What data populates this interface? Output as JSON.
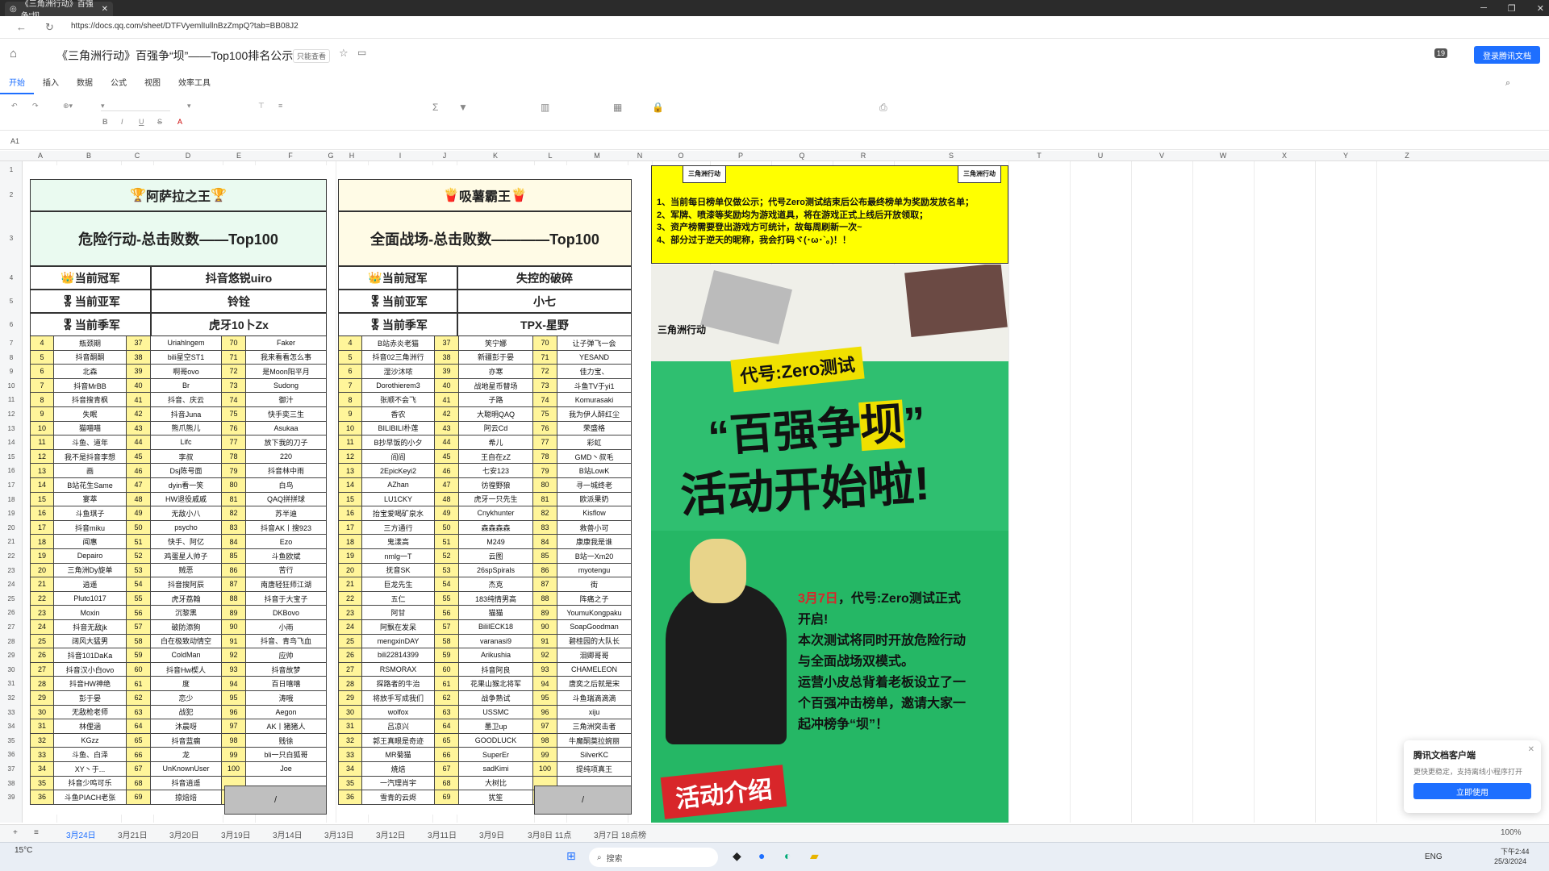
{
  "browser": {
    "tab_title": "《三角洲行动》百强争“坝",
    "url": "https://docs.qq.com/sheet/DTFVyemlIullnBzZmpQ?tab=BB08J2"
  },
  "doc": {
    "title": "《三角洲行动》百强争“坝”——Top100排名公示",
    "save_state": "只能查看",
    "login_button": "登录腾讯文档",
    "collab_count": "19"
  },
  "menu": [
    "开始",
    "插入",
    "数据",
    "公式",
    "视图",
    "效率工具"
  ],
  "cell_ref": "A1",
  "columns": [
    "A",
    "B",
    "C",
    "D",
    "E",
    "F",
    "G",
    "H",
    "I",
    "J",
    "K",
    "L",
    "M",
    "N",
    "O",
    "P",
    "Q",
    "R",
    "S",
    "T",
    "U",
    "V",
    "W",
    "X",
    "Y",
    "Z"
  ],
  "rows": [
    "1",
    "2",
    "3",
    "4",
    "5",
    "6",
    "7",
    "8",
    "9",
    "10",
    "11",
    "12",
    "13",
    "14",
    "15",
    "16",
    "17",
    "18",
    "19",
    "20",
    "21",
    "22",
    "23",
    "24",
    "25",
    "26",
    "27",
    "28",
    "29",
    "30",
    "31",
    "32",
    "33",
    "34",
    "35",
    "36",
    "37",
    "38",
    "39"
  ],
  "left": {
    "badge": "阿萨拉之王",
    "title": "危险行动-总击败数——Top100",
    "champ_label": "当前冠军",
    "champ": "抖音悠锐uiro",
    "runner_label": "当前亚军",
    "runner": "铃铨",
    "third_label": "当前季军",
    "third": "虎牙10卜Zx",
    "rows": [
      [
        "4",
        "瓶颈期",
        "37",
        "Uriahlngem",
        "70",
        "Faker"
      ],
      [
        "5",
        "抖音酮酮",
        "38",
        "bili星空ST1",
        "71",
        "我来看看怎么事"
      ],
      [
        "6",
        "北森",
        "39",
        "啊哥ovo",
        "72",
        "是Moon阳平月"
      ],
      [
        "7",
        "抖音MrBB",
        "40",
        "Br",
        "73",
        "Sudong"
      ],
      [
        "8",
        "抖音搜青枫",
        "41",
        "抖音、庆云",
        "74",
        "御汁"
      ],
      [
        "9",
        "失眠",
        "42",
        "抖音Juna",
        "75",
        "快手奕三生"
      ],
      [
        "10",
        "猫喵喵",
        "43",
        "熊爪熊儿",
        "76",
        "Asukaa"
      ],
      [
        "11",
        "斗鱼、道年",
        "44",
        "Lifc",
        "77",
        "放下我的刀子"
      ],
      [
        "12",
        "我不是抖音李想",
        "45",
        "李叔",
        "78",
        "220"
      ],
      [
        "13",
        "画",
        "46",
        "Dsj陈号面",
        "79",
        "抖音林中雨"
      ],
      [
        "14",
        "B站花生Same",
        "47",
        "dyin看一笑",
        "80",
        "白鸟"
      ],
      [
        "15",
        "宴萃",
        "48",
        "HW退役戚戚",
        "81",
        "QAQ拼拼球"
      ],
      [
        "16",
        "斗鱼琪子",
        "49",
        "无敌小八",
        "82",
        "苏半迪"
      ],
      [
        "17",
        "抖音miku",
        "50",
        "psycho",
        "83",
        "抖音AK丨搜923"
      ],
      [
        "18",
        "闻惠",
        "51",
        "快手、阿亿",
        "84",
        "Ezo"
      ],
      [
        "19",
        "Depairo",
        "52",
        "鸡蛋星人帅子",
        "85",
        "斗鱼欧斌"
      ],
      [
        "20",
        "三角洲Dy旋单",
        "53",
        "贼恶",
        "86",
        "苦行"
      ],
      [
        "21",
        "逍遥",
        "54",
        "抖音搜阿辰",
        "87",
        "南唐轻狂师江湖"
      ],
      [
        "22",
        "Pluto1017",
        "55",
        "虎牙荔翰",
        "88",
        "抖音于大宝子"
      ],
      [
        "23",
        "Moxin",
        "56",
        "沉黎黑",
        "89",
        "DKBovo"
      ],
      [
        "24",
        "抖音无敌jk",
        "57",
        "破防添狗",
        "90",
        "小雨"
      ],
      [
        "25",
        "阔风大猛男",
        "58",
        "白在极致动情空",
        "91",
        "抖音、青鸟飞血"
      ],
      [
        "26",
        "抖音101DaKa",
        "59",
        "ColdMan",
        "92",
        "应帅"
      ],
      [
        "27",
        "抖音汉小白ovo",
        "60",
        "抖音Hw楔人",
        "93",
        "抖音故梦"
      ],
      [
        "28",
        "抖音HW神绝",
        "61",
        "度",
        "94",
        "百日嘻嘻"
      ],
      [
        "29",
        "彭于晏",
        "62",
        "恋少",
        "95",
        "涛哦"
      ],
      [
        "30",
        "无敌枪老师",
        "63",
        "战犯",
        "96",
        "Aegon"
      ],
      [
        "31",
        "林俚涵",
        "64",
        "沐晨呀",
        "97",
        "AK丨猪猪人"
      ],
      [
        "32",
        "KGzz",
        "65",
        "抖音蓝瘸",
        "98",
        "贱徐"
      ],
      [
        "33",
        "斗鱼、白泽",
        "66",
        "龙",
        "99",
        "bli一只白狐哥"
      ],
      [
        "34",
        "XY丶于...",
        "67",
        "UnKnownUser",
        "100",
        "Joe"
      ],
      [
        "35",
        "抖音少鸣可乐",
        "68",
        "抖音逍遥",
        "",
        ""
      ],
      [
        "36",
        "斗鱼PIACH老张",
        "69",
        "掠焙焙",
        "",
        ""
      ]
    ],
    "slash": "/"
  },
  "right": {
    "badge": "吸薯霸王",
    "title": "全面战场-总击败数————Top100",
    "champ_label": "当前冠军",
    "champ": "失控的破碎",
    "runner_label": "当前亚军",
    "runner": "小七",
    "third_label": "当前季军",
    "third": "TPX-星野",
    "rows": [
      [
        "4",
        "B站赤炎老猫",
        "37",
        "笑宁娜",
        "70",
        "让子弹飞一会"
      ],
      [
        "5",
        "抖音02三角洲行",
        "38",
        "新疆彭于晏",
        "71",
        "YESAND"
      ],
      [
        "6",
        "湿沙沐哝",
        "39",
        "亦寒",
        "72",
        "佳力宝、"
      ],
      [
        "7",
        "Dorothierem3",
        "40",
        "战地星币替场",
        "73",
        "斗鱼TV于yi1"
      ],
      [
        "8",
        "张顺不会飞",
        "41",
        "子路",
        "74",
        "Komurasaki"
      ],
      [
        "9",
        "香农",
        "42",
        "大聪明QAQ",
        "75",
        "我为伊人醉红尘"
      ],
      [
        "10",
        "BILIBILI朴莲",
        "43",
        "阿云Cd",
        "76",
        "荣盛格"
      ],
      [
        "11",
        "B抄早饭的小夕",
        "44",
        "希儿",
        "77",
        "彩虹"
      ],
      [
        "12",
        "阎阎",
        "45",
        "王自在zZ",
        "78",
        "GMD丶叔毛"
      ],
      [
        "13",
        "2EpicKeyi2",
        "46",
        "七安123",
        "79",
        "B站LowK"
      ],
      [
        "14",
        "AZhan",
        "47",
        "彷徨野狼",
        "80",
        "寻一城终老"
      ],
      [
        "15",
        "LU1CKY",
        "48",
        "虎牙一只先生",
        "81",
        "欧派果奶"
      ],
      [
        "16",
        "抬宝爱喝矿泉水",
        "49",
        "Cnykhunter",
        "82",
        "Kisflow"
      ],
      [
        "17",
        "三方通行",
        "50",
        "森森森森",
        "83",
        "救兽小可"
      ],
      [
        "18",
        "鬼漾高",
        "51",
        "M249",
        "84",
        "康康我是谁"
      ],
      [
        "19",
        "nmlg一T",
        "52",
        "云图",
        "85",
        "B站一Xm20"
      ],
      [
        "20",
        "抚音SK",
        "53",
        "26spSpirals",
        "86",
        "myotengu"
      ],
      [
        "21",
        "巨龙先生",
        "54",
        "杰克",
        "87",
        "街"
      ],
      [
        "22",
        "五仁",
        "55",
        "183纯情男高",
        "88",
        "阵痛之子"
      ],
      [
        "23",
        "阿甘",
        "56",
        "猫猫",
        "89",
        "YoumuKongpaku"
      ],
      [
        "24",
        "阿飘在发呆",
        "57",
        "BiliIECK18",
        "90",
        "SoapGoodman"
      ],
      [
        "25",
        "mengxinDAY",
        "58",
        "varanasi9",
        "91",
        "碧桂园的大队长"
      ],
      [
        "26",
        "bili22814399",
        "59",
        "Arikushia",
        "92",
        "泪卿哥哥"
      ],
      [
        "27",
        "RSMORAX",
        "60",
        "抖音阿良",
        "93",
        "CHAMELEON"
      ],
      [
        "28",
        "探路者的牛治",
        "61",
        "花果山猴北将军",
        "94",
        "唐奕之后就是宋"
      ],
      [
        "29",
        "将放手写成我们",
        "62",
        "战争熟试",
        "95",
        "斗鱼瑞滴滴滴"
      ],
      [
        "30",
        "wolfox",
        "63",
        "USSMC",
        "96",
        "xiju"
      ],
      [
        "31",
        "吕凉兴",
        "64",
        "墨卫up",
        "97",
        "三角洲突击者"
      ],
      [
        "32",
        "郭王真眼是奇迹",
        "65",
        "GOODLUCK",
        "98",
        "牛魔酮莫拉婉丽"
      ],
      [
        "33",
        "MR菊猫",
        "66",
        "SuperEr",
        "99",
        "SilverKC"
      ],
      [
        "34",
        "焼焙",
        "67",
        "sadKimi",
        "100",
        "提纯项真王"
      ],
      [
        "35",
        "一汽理肖宇",
        "68",
        "大树比",
        "",
        " "
      ],
      [
        "36",
        "雪青的云烬",
        "69",
        "犹笙",
        "",
        " "
      ]
    ],
    "slash": "/"
  },
  "notice": [
    "1、当前每日榜单仅做公示；代号Zero测试结束后公布最终榜单为奖励发放名单；",
    "2、军牌、喷漆等奖励均为游戏道具，将在游戏正式上线后开放领取；",
    "3、资产榜需要登出游戏方可统计，故每周刷新一次~",
    "4、部分过于逆天的昵称，我会打码ヾ(･ω･`。)！！"
  ],
  "notice_tags": [
    "三角洲行动",
    "三角洲行动"
  ],
  "poster": {
    "brand": "三角洲行动",
    "code": "代号:Zero测试",
    "headline1": "“百强争",
    "headline1_hl": "坝",
    "headline1_end": "”",
    "headline2": "活动开始啦!",
    "date": "3月7日",
    "lines": [
      "代号:Zero测试正式",
      "开启!",
      "本次测试将同时开放危险行动",
      "与全面战场双模式。",
      "运营小皮总背着老板设立了一",
      "个百强冲击榜单，邀请大家一",
      "起冲榜争“坝”！"
    ],
    "footer": "活动介绍"
  },
  "sheets": [
    "3月24日",
    "3月21日",
    "3月20日",
    "3月19日",
    "3月14日",
    "3月13日",
    "3月12日",
    "3月11日",
    "3月9日",
    "3月8日 11点",
    "3月7日 18点榜"
  ],
  "popup": {
    "title": "腾讯文档客户端",
    "desc": "更快更稳定，支持离线小程序打开",
    "button": "立即使用"
  },
  "zoom": "100%",
  "taskbar": {
    "weather": "15°C",
    "search": "搜索",
    "ime": "ENG",
    "time": "下午2:44",
    "date": "25/3/2024"
  }
}
